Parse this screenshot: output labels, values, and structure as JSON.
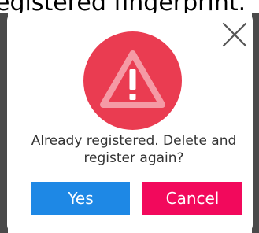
{
  "background": {
    "partial_text": "egistered fingerprint."
  },
  "dialog": {
    "message": "Already registered. Delete and register again?",
    "yes_label": "Yes",
    "cancel_label": "Cancel",
    "icons": {
      "close": "close-icon",
      "alert": "warning-triangle-icon"
    }
  },
  "colors": {
    "alert_circle": "#ea3c51",
    "yes_button": "#1e88e5",
    "cancel_button": "#f2095c",
    "message_text": "#333333"
  }
}
